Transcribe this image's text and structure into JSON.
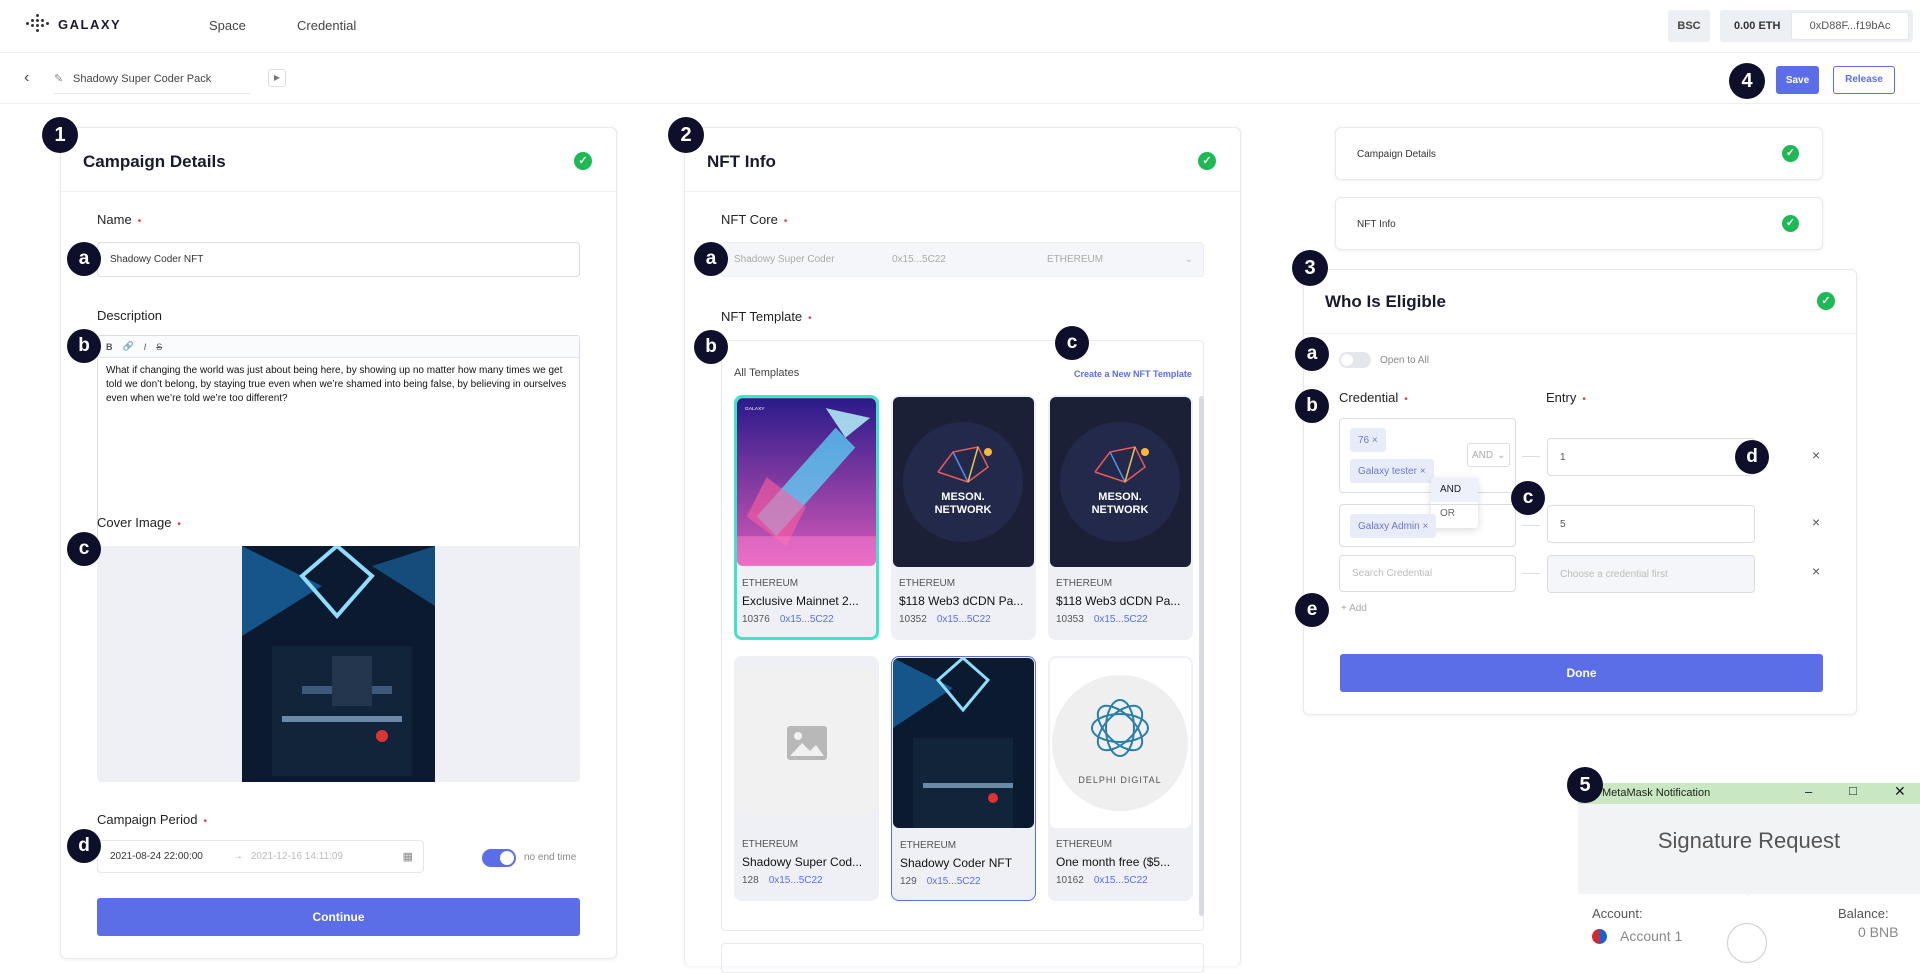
{
  "header": {
    "logo": "GALAXY",
    "nav": [
      "Space",
      "Credential"
    ],
    "network": "BSC",
    "balance": "0.00 ETH",
    "address": "0xD88F...f19bAc"
  },
  "subbar": {
    "campaign_name": "Shadowy Super Coder Pack",
    "save": "Save",
    "release": "Release"
  },
  "badges": {
    "n1": "1",
    "n2": "2",
    "n3": "3",
    "n4": "4",
    "n5": "5",
    "a": "a",
    "b": "b",
    "c": "c",
    "d": "d",
    "e": "e"
  },
  "campaign": {
    "title": "Campaign Details",
    "name_label": "Name",
    "name_value": "Shadowy Coder NFT",
    "desc_label": "Description",
    "desc_tools": [
      "B",
      "🔗",
      "I",
      "S"
    ],
    "desc_value": "What if changing the world was just about being here, by showing up no matter how many times we get told we don’t belong, by staying true even when we’re shamed into being false, by believing in ourselves even when we’re told we’re too different?",
    "cover_label": "Cover Image",
    "period_label": "Campaign Period",
    "start": "2021-08-24 22:00:00",
    "end": "2021-12-16 14:11:09",
    "no_end": "no end time",
    "continue": "Continue"
  },
  "nftinfo": {
    "title": "NFT Info",
    "core_label": "NFT Core",
    "core_name": "Shadowy Super Coder",
    "core_addr": "0x15...5C22",
    "core_chain": "ETHEREUM",
    "template_label": "NFT Template",
    "all_templates": "All Templates",
    "create_link": "Create a New NFT Template",
    "meson_line1": "MESON.",
    "meson_line2": "NETWORK",
    "delphi": "DELPHI DIGITAL",
    "galaxy_mini": "GALAXY",
    "templates": [
      {
        "chain": "ETHEREUM",
        "name": "Exclusive Mainnet 2...",
        "id": "10376",
        "addr": "0x15...5C22"
      },
      {
        "chain": "ETHEREUM",
        "name": "$118 Web3 dCDN Pa...",
        "id": "10352",
        "addr": "0x15...5C22"
      },
      {
        "chain": "ETHEREUM",
        "name": "$118 Web3 dCDN Pa...",
        "id": "10353",
        "addr": "0x15...5C22"
      },
      {
        "chain": "ETHEREUM",
        "name": "Shadowy Super Cod...",
        "id": "128",
        "addr": "0x15...5C22"
      },
      {
        "chain": "ETHEREUM",
        "name": "Shadowy Coder NFT",
        "id": "129",
        "addr": "0x15...5C22"
      },
      {
        "chain": "ETHEREUM",
        "name": "One month free ($5...",
        "id": "10162",
        "addr": "0x15...5C22"
      }
    ]
  },
  "sidesteps": {
    "campaign": "Campaign Details",
    "nftinfo": "NFT Info"
  },
  "eligible": {
    "title": "Who Is Eligible",
    "open_all": "Open to All",
    "credential_label": "Credential",
    "entry_label": "Entry",
    "tags": [
      "76",
      "Galaxy tester",
      "Galaxy Admin"
    ],
    "op": "AND",
    "op_options": [
      "AND",
      "OR"
    ],
    "entry1": "1",
    "entry2": "5",
    "search_placeholder": "Search Credential",
    "entry_placeholder": "Choose a credential first",
    "add": "Add",
    "done": "Done"
  },
  "metamask": {
    "window_title": "MetaMask Notification",
    "heading": "Signature Request",
    "account_label": "Account:",
    "account": "Account 1",
    "balance_label": "Balance:",
    "balance": "0 BNB"
  }
}
